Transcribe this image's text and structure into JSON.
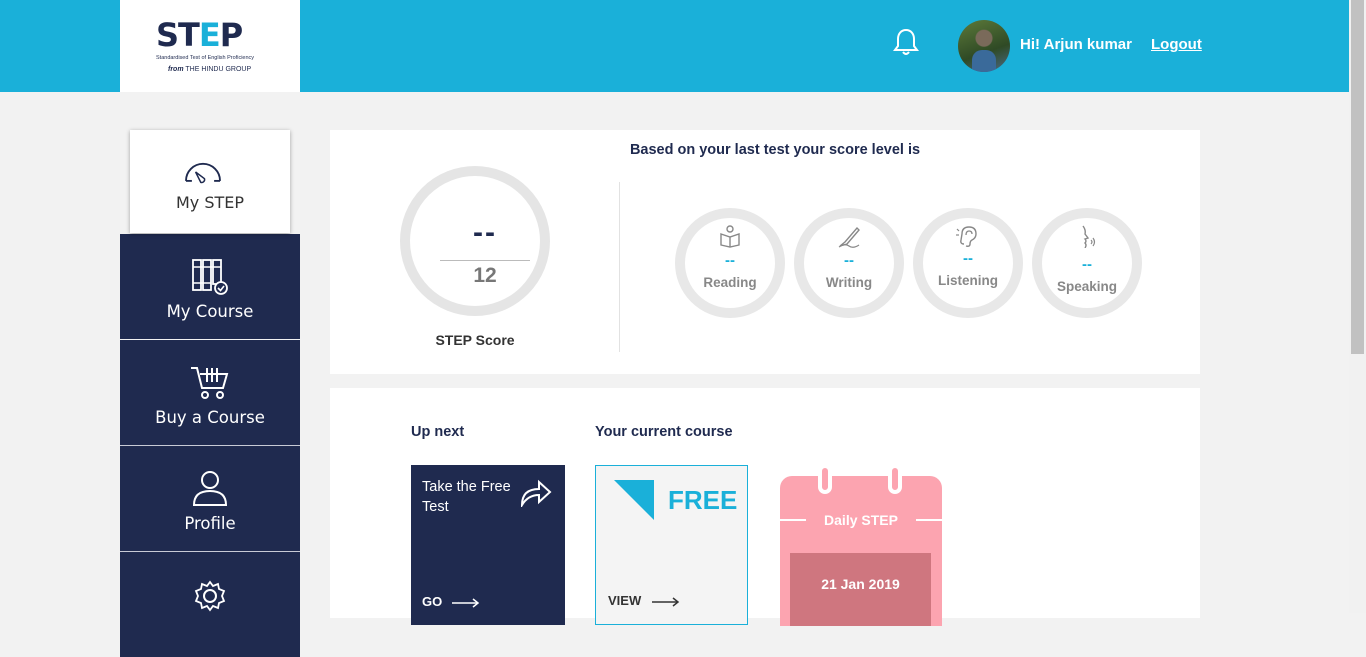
{
  "header": {
    "logo_text_st": "ST",
    "logo_text_e": "E",
    "logo_text_p": "P",
    "logo_subtitle": "Standardised Test of English Proficiency",
    "logo_from_prefix": "from",
    "logo_from_org": "THE HINDU GROUP",
    "greeting": "Hi! Arjun kumar",
    "logout_label": "Logout",
    "bell_icon": "bell-icon",
    "accent_color": "#1ab0d9",
    "nav_color": "#1f2a4f"
  },
  "sidebar": {
    "items": [
      {
        "label": "My STEP",
        "icon": "speedometer-icon",
        "active": true
      },
      {
        "label": "My Course",
        "icon": "books-check-icon"
      },
      {
        "label": "Buy a Course",
        "icon": "cart-icon"
      },
      {
        "label": "Profile",
        "icon": "user-icon"
      },
      {
        "label": "",
        "icon": "settings-gear-icon"
      }
    ]
  },
  "score": {
    "title": "Based on your last test your score level is",
    "value": "--",
    "max": "12",
    "label": "STEP Score",
    "skills": [
      {
        "name": "Reading",
        "value": "--",
        "icon": "reading-icon"
      },
      {
        "name": "Writing",
        "value": "--",
        "icon": "writing-icon"
      },
      {
        "name": "Listening",
        "value": "--",
        "icon": "listening-ear-icon"
      },
      {
        "name": "Speaking",
        "value": "--",
        "icon": "speaking-face-icon"
      }
    ]
  },
  "panel": {
    "up_next_label": "Up next",
    "current_course_label": "Your current course",
    "next_card": {
      "text": "Take the Free Test",
      "action": "GO"
    },
    "course_card": {
      "badge": "FREE",
      "action": "VIEW"
    },
    "daily": {
      "title": "Daily STEP",
      "date": "21 Jan 2019"
    }
  }
}
